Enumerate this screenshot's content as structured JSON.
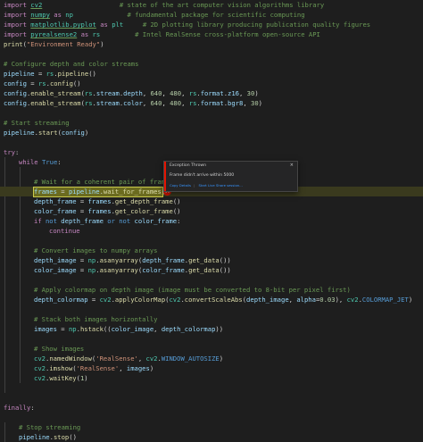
{
  "editor": {
    "lines": [
      {
        "indent": 0,
        "tokens": [
          {
            "t": "import",
            "c": "kw"
          },
          {
            "t": " "
          },
          {
            "t": "cv2",
            "c": "mod ul"
          },
          {
            "t": "                    "
          },
          {
            "t": "# state of the art computer vision algorithms library",
            "c": "cmt"
          }
        ]
      },
      {
        "indent": 0,
        "tokens": [
          {
            "t": "import",
            "c": "kw"
          },
          {
            "t": " "
          },
          {
            "t": "numpy",
            "c": "mod ul"
          },
          {
            "t": " "
          },
          {
            "t": "as",
            "c": "kw"
          },
          {
            "t": " "
          },
          {
            "t": "np",
            "c": "mod"
          },
          {
            "t": "              "
          },
          {
            "t": "# fundamental package for scientific computing",
            "c": "cmt"
          }
        ]
      },
      {
        "indent": 0,
        "tokens": [
          {
            "t": "import",
            "c": "kw"
          },
          {
            "t": " "
          },
          {
            "t": "matplotlib.pyplot",
            "c": "mod ul"
          },
          {
            "t": " "
          },
          {
            "t": "as",
            "c": "kw"
          },
          {
            "t": " "
          },
          {
            "t": "plt",
            "c": "mod"
          },
          {
            "t": "     "
          },
          {
            "t": "# 2D plotting library producing publication quality figures",
            "c": "cmt"
          }
        ]
      },
      {
        "indent": 0,
        "tokens": [
          {
            "t": "import",
            "c": "kw"
          },
          {
            "t": " "
          },
          {
            "t": "pyrealsense2",
            "c": "mod ul"
          },
          {
            "t": " "
          },
          {
            "t": "as",
            "c": "kw"
          },
          {
            "t": " "
          },
          {
            "t": "rs",
            "c": "mod"
          },
          {
            "t": "         "
          },
          {
            "t": "# Intel RealSense cross-platform open-source API",
            "c": "cmt"
          }
        ]
      },
      {
        "indent": 0,
        "tokens": [
          {
            "t": "print",
            "c": "fn"
          },
          {
            "t": "("
          },
          {
            "t": "\"Environment Ready\"",
            "c": "str"
          },
          {
            "t": ")"
          }
        ]
      },
      {
        "indent": 0,
        "tokens": []
      },
      {
        "indent": 0,
        "tokens": [
          {
            "t": "# Configure depth and color streams",
            "c": "cmt"
          }
        ]
      },
      {
        "indent": 0,
        "tokens": [
          {
            "t": "pipeline",
            "c": "var"
          },
          {
            "t": " = "
          },
          {
            "t": "rs",
            "c": "mod"
          },
          {
            "t": "."
          },
          {
            "t": "pipeline",
            "c": "fn"
          },
          {
            "t": "()"
          }
        ]
      },
      {
        "indent": 0,
        "tokens": [
          {
            "t": "config",
            "c": "var"
          },
          {
            "t": " = "
          },
          {
            "t": "rs",
            "c": "mod"
          },
          {
            "t": "."
          },
          {
            "t": "config",
            "c": "fn"
          },
          {
            "t": "()"
          }
        ]
      },
      {
        "indent": 0,
        "tokens": [
          {
            "t": "config",
            "c": "var"
          },
          {
            "t": "."
          },
          {
            "t": "enable_stream",
            "c": "fn"
          },
          {
            "t": "("
          },
          {
            "t": "rs",
            "c": "mod"
          },
          {
            "t": "."
          },
          {
            "t": "stream",
            "c": "var"
          },
          {
            "t": "."
          },
          {
            "t": "depth",
            "c": "var"
          },
          {
            "t": ", "
          },
          {
            "t": "640",
            "c": "num"
          },
          {
            "t": ", "
          },
          {
            "t": "480",
            "c": "num"
          },
          {
            "t": ", "
          },
          {
            "t": "rs",
            "c": "mod"
          },
          {
            "t": "."
          },
          {
            "t": "format",
            "c": "var"
          },
          {
            "t": "."
          },
          {
            "t": "z16",
            "c": "var"
          },
          {
            "t": ", "
          },
          {
            "t": "30",
            "c": "num"
          },
          {
            "t": ")"
          }
        ]
      },
      {
        "indent": 0,
        "tokens": [
          {
            "t": "config",
            "c": "var"
          },
          {
            "t": "."
          },
          {
            "t": "enable_stream",
            "c": "fn"
          },
          {
            "t": "("
          },
          {
            "t": "rs",
            "c": "mod"
          },
          {
            "t": "."
          },
          {
            "t": "stream",
            "c": "var"
          },
          {
            "t": "."
          },
          {
            "t": "color",
            "c": "var"
          },
          {
            "t": ", "
          },
          {
            "t": "640",
            "c": "num"
          },
          {
            "t": ", "
          },
          {
            "t": "480",
            "c": "num"
          },
          {
            "t": ", "
          },
          {
            "t": "rs",
            "c": "mod"
          },
          {
            "t": "."
          },
          {
            "t": "format",
            "c": "var"
          },
          {
            "t": "."
          },
          {
            "t": "bgr8",
            "c": "var"
          },
          {
            "t": ", "
          },
          {
            "t": "30",
            "c": "num"
          },
          {
            "t": ")"
          }
        ]
      },
      {
        "indent": 0,
        "tokens": []
      },
      {
        "indent": 0,
        "tokens": [
          {
            "t": "# Start streaming",
            "c": "cmt"
          }
        ]
      },
      {
        "indent": 0,
        "tokens": [
          {
            "t": "pipeline",
            "c": "var"
          },
          {
            "t": "."
          },
          {
            "t": "start",
            "c": "fn"
          },
          {
            "t": "("
          },
          {
            "t": "config",
            "c": "var"
          },
          {
            "t": ")"
          }
        ]
      },
      {
        "indent": 0,
        "tokens": []
      },
      {
        "indent": 0,
        "tokens": [
          {
            "t": "try",
            "c": "kw"
          },
          {
            "t": ":"
          }
        ]
      },
      {
        "indent": 1,
        "tokens": [
          {
            "t": "while",
            "c": "kw"
          },
          {
            "t": " "
          },
          {
            "t": "True",
            "c": "blue"
          },
          {
            "t": ":"
          }
        ]
      },
      {
        "indent": 0,
        "tokens": []
      },
      {
        "indent": 2,
        "tokens": [
          {
            "t": "# Wait for a coherent pair of frames: depth and color",
            "c": "cmt"
          }
        ]
      },
      {
        "indent": 2,
        "tokens": [
          {
            "t": "frames",
            "c": "var"
          },
          {
            "t": " = "
          },
          {
            "t": "pipeline",
            "c": "var"
          },
          {
            "t": "."
          },
          {
            "t": "wait_for_frames",
            "c": "fn"
          },
          {
            "t": "()"
          }
        ]
      },
      {
        "indent": 2,
        "tokens": [
          {
            "t": "depth_frame",
            "c": "var"
          },
          {
            "t": " = "
          },
          {
            "t": "frames",
            "c": "var"
          },
          {
            "t": "."
          },
          {
            "t": "get_depth_frame",
            "c": "fn"
          },
          {
            "t": "()"
          }
        ]
      },
      {
        "indent": 2,
        "tokens": [
          {
            "t": "color_frame",
            "c": "var"
          },
          {
            "t": " = "
          },
          {
            "t": "frames",
            "c": "var"
          },
          {
            "t": "."
          },
          {
            "t": "get_color_frame",
            "c": "fn"
          },
          {
            "t": "()"
          }
        ]
      },
      {
        "indent": 2,
        "tokens": [
          {
            "t": "if",
            "c": "kw"
          },
          {
            "t": " "
          },
          {
            "t": "not",
            "c": "blue"
          },
          {
            "t": " "
          },
          {
            "t": "depth_frame",
            "c": "var"
          },
          {
            "t": " "
          },
          {
            "t": "or",
            "c": "blue"
          },
          {
            "t": " "
          },
          {
            "t": "not",
            "c": "blue"
          },
          {
            "t": " "
          },
          {
            "t": "color_frame",
            "c": "var"
          },
          {
            "t": ":"
          }
        ]
      },
      {
        "indent": 3,
        "tokens": [
          {
            "t": "continue",
            "c": "kw"
          }
        ]
      },
      {
        "indent": 0,
        "tokens": []
      },
      {
        "indent": 2,
        "tokens": [
          {
            "t": "# Convert images to numpy arrays",
            "c": "cmt"
          }
        ]
      },
      {
        "indent": 2,
        "tokens": [
          {
            "t": "depth_image",
            "c": "var"
          },
          {
            "t": " = "
          },
          {
            "t": "np",
            "c": "mod"
          },
          {
            "t": "."
          },
          {
            "t": "asanyarray",
            "c": "fn"
          },
          {
            "t": "("
          },
          {
            "t": "depth_frame",
            "c": "var"
          },
          {
            "t": "."
          },
          {
            "t": "get_data",
            "c": "fn"
          },
          {
            "t": "())"
          }
        ]
      },
      {
        "indent": 2,
        "tokens": [
          {
            "t": "color_image",
            "c": "var"
          },
          {
            "t": " = "
          },
          {
            "t": "np",
            "c": "mod"
          },
          {
            "t": "."
          },
          {
            "t": "asanyarray",
            "c": "fn"
          },
          {
            "t": "("
          },
          {
            "t": "color_frame",
            "c": "var"
          },
          {
            "t": "."
          },
          {
            "t": "get_data",
            "c": "fn"
          },
          {
            "t": "())"
          }
        ]
      },
      {
        "indent": 0,
        "tokens": []
      },
      {
        "indent": 2,
        "tokens": [
          {
            "t": "# Apply colormap on depth image (image must be converted to 8-bit per pixel first)",
            "c": "cmt"
          }
        ]
      },
      {
        "indent": 2,
        "tokens": [
          {
            "t": "depth_colormap",
            "c": "var"
          },
          {
            "t": " = "
          },
          {
            "t": "cv2",
            "c": "mod"
          },
          {
            "t": "."
          },
          {
            "t": "applyColorMap",
            "c": "fn"
          },
          {
            "t": "("
          },
          {
            "t": "cv2",
            "c": "mod"
          },
          {
            "t": "."
          },
          {
            "t": "convertScaleAbs",
            "c": "fn"
          },
          {
            "t": "("
          },
          {
            "t": "depth_image",
            "c": "var"
          },
          {
            "t": ", "
          },
          {
            "t": "alpha",
            "c": "var"
          },
          {
            "t": "="
          },
          {
            "t": "0.03",
            "c": "num"
          },
          {
            "t": "), "
          },
          {
            "t": "cv2",
            "c": "mod"
          },
          {
            "t": "."
          },
          {
            "t": "COLORMAP_JET",
            "c": "blue"
          },
          {
            "t": ")"
          }
        ]
      },
      {
        "indent": 0,
        "tokens": []
      },
      {
        "indent": 2,
        "tokens": [
          {
            "t": "# Stack both images horizontally",
            "c": "cmt"
          }
        ]
      },
      {
        "indent": 2,
        "tokens": [
          {
            "t": "images",
            "c": "var"
          },
          {
            "t": " = "
          },
          {
            "t": "np",
            "c": "mod"
          },
          {
            "t": "."
          },
          {
            "t": "hstack",
            "c": "fn"
          },
          {
            "t": "(("
          },
          {
            "t": "color_image",
            "c": "var"
          },
          {
            "t": ", "
          },
          {
            "t": "depth_colormap",
            "c": "var"
          },
          {
            "t": "))"
          }
        ]
      },
      {
        "indent": 0,
        "tokens": []
      },
      {
        "indent": 2,
        "tokens": [
          {
            "t": "# Show images",
            "c": "cmt"
          }
        ]
      },
      {
        "indent": 2,
        "tokens": [
          {
            "t": "cv2",
            "c": "mod"
          },
          {
            "t": "."
          },
          {
            "t": "namedWindow",
            "c": "fn"
          },
          {
            "t": "("
          },
          {
            "t": "'RealSense'",
            "c": "str"
          },
          {
            "t": ", "
          },
          {
            "t": "cv2",
            "c": "mod"
          },
          {
            "t": "."
          },
          {
            "t": "WINDOW_AUTOSIZE",
            "c": "blue"
          },
          {
            "t": ")"
          }
        ]
      },
      {
        "indent": 2,
        "tokens": [
          {
            "t": "cv2",
            "c": "mod"
          },
          {
            "t": "."
          },
          {
            "t": "imshow",
            "c": "fn"
          },
          {
            "t": "("
          },
          {
            "t": "'RealSense'",
            "c": "str"
          },
          {
            "t": ", "
          },
          {
            "t": "images",
            "c": "var"
          },
          {
            "t": ")"
          }
        ]
      },
      {
        "indent": 2,
        "tokens": [
          {
            "t": "cv2",
            "c": "mod"
          },
          {
            "t": "."
          },
          {
            "t": "waitKey",
            "c": "fn"
          },
          {
            "t": "("
          },
          {
            "t": "1",
            "c": "num"
          },
          {
            "t": ")"
          }
        ]
      },
      {
        "indent": 0,
        "tokens": []
      },
      {
        "indent": 0,
        "tokens": []
      },
      {
        "indent": 0,
        "tokens": [
          {
            "t": "finally",
            "c": "kw"
          },
          {
            "t": ":"
          }
        ]
      },
      {
        "indent": 0,
        "tokens": []
      },
      {
        "indent": 1,
        "tokens": [
          {
            "t": "# Stop streaming",
            "c": "cmt"
          }
        ]
      },
      {
        "indent": 1,
        "tokens": [
          {
            "t": "pipeline",
            "c": "var"
          },
          {
            "t": "."
          },
          {
            "t": "stop",
            "c": "fn"
          },
          {
            "t": "()"
          }
        ]
      }
    ]
  },
  "exception_popup": {
    "title": "Exception Thrown",
    "close_icon": "×",
    "message": "Frame didn't arrive within 5000",
    "link_copy": "Copy Details",
    "link_live_share": "Start Live Share session..."
  },
  "error_glyph": "×",
  "colors": {
    "background": "#1e1e1e",
    "exec_line": "#6b6b1f",
    "error": "#e51400",
    "link": "#3794ff"
  }
}
